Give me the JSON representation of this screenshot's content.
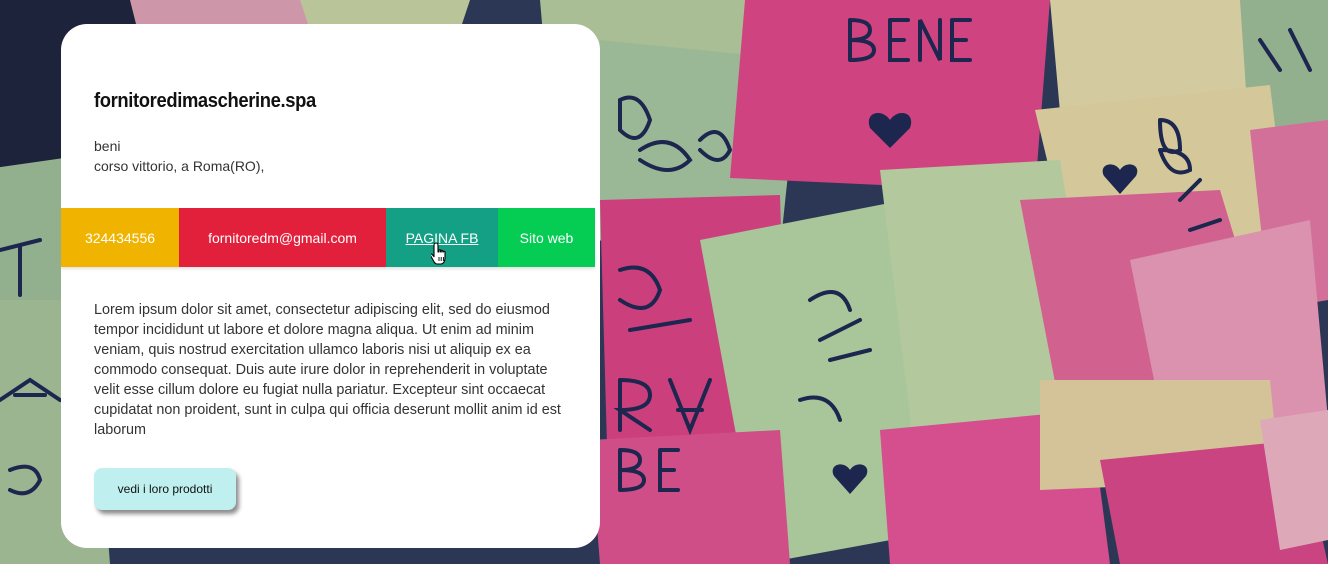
{
  "card": {
    "title": "fornitoredimascherine.spa",
    "address_line1": "beni",
    "address_line2": "corso vittorio, a Roma(RO),",
    "description": "Lorem ipsum dolor sit amet, consectetur adipiscing elit, sed do eiusmod tempor incididunt ut labore et dolore magna aliqua. Ut enim ad minim veniam, quis nostrud exercitation ullamco laboris nisi ut aliquip ex ea commodo consequat. Duis aute irure dolor in reprehenderit in voluptate velit esse cillum dolore eu fugiat nulla pariatur. Excepteur sint occaecat cupidatat non proident, sunt in culpa qui officia deserunt mollit anim id est laborum",
    "button_label": "vedi i loro prodotti"
  },
  "contacts": {
    "phone": "324434556",
    "email": "fornitoredm@gmail.com",
    "facebook": "PAGINA FB",
    "website": "Sito web"
  },
  "colors": {
    "phone_bg": "#f0b400",
    "email_bg": "#e3203c",
    "facebook_bg": "#14a085",
    "website_bg": "#05cc53",
    "button_bg": "#bff0ef",
    "card_bg": "#ffffff"
  },
  "background": {
    "note_texts": [
      "BENE",
      "TI ANDRA BENE",
      "ANDRÀ BENE",
      "BENE"
    ]
  },
  "icons": {
    "cursor": "hand-pointer-icon",
    "heart": "heart-icon"
  }
}
